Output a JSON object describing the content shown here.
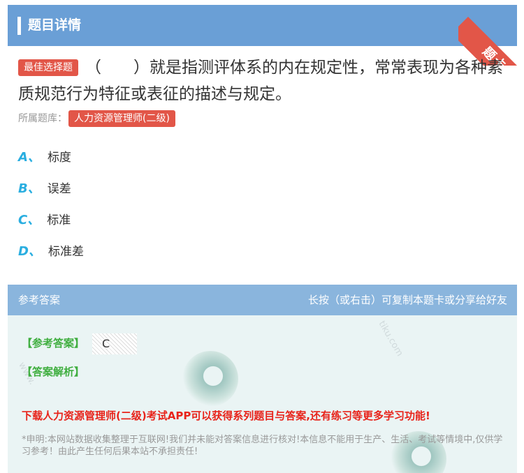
{
  "header": {
    "title": "题目详情",
    "corner_badge": "题卡"
  },
  "question": {
    "type_tag": "最佳选择题",
    "text": "（　　）就是指测评体系的内在规定性，常常表现为各种素质规范行为特征或表征的描述与规定。",
    "bank_label": "所属题库：",
    "bank_name": "人力资源管理师(二级)"
  },
  "options": [
    {
      "letter": "A、",
      "text": "标度"
    },
    {
      "letter": "B、",
      "text": "误差"
    },
    {
      "letter": "C、",
      "text": "标准"
    },
    {
      "letter": "D、",
      "text": "标准差"
    }
  ],
  "answer": {
    "section_title": "参考答案",
    "share_hint": "长按（或右击）可复制本题卡或分享给好友",
    "answer_label": "【参考答案】",
    "answer_value": "C",
    "analysis_label": "【答案解析】",
    "promo": "下载人力资源管理师(二级)考试APP可以获得系列题目与答案,还有练习等更多学习功能!",
    "disclaimer": "*申明:本网站数据收集整理于互联网!我们并未能对答案信息进行核对!本信息不能用于生产、生活、考试等情境中,仅供学习参考！由此产生任何后果本站不承担责任!"
  },
  "colors": {
    "header_bg": "#6a9fd6",
    "tag_red": "#e25648",
    "option_letter": "#2aaee0",
    "answer_green": "#3fae3f",
    "promo_red": "#e8231a"
  }
}
